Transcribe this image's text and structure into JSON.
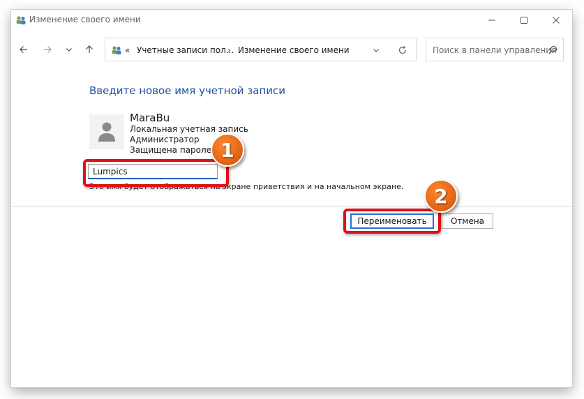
{
  "window": {
    "title": "Изменение своего имени",
    "title_icon": "user-accounts-icon"
  },
  "navigation": {
    "breadcrumb_overflow": "«",
    "breadcrumbs": [
      "Учетные записи пол...",
      "Изменение своего имени"
    ],
    "search_placeholder": "Поиск в панели управления"
  },
  "main": {
    "heading": "Введите новое имя учетной записи",
    "user": {
      "name": "MaraBu",
      "type": "Локальная учетная запись",
      "role": "Администратор",
      "protection": "Защищена паролем",
      "avatar_icon": "user-avatar-icon"
    },
    "name_input": {
      "value": "Lumpics"
    },
    "hint": "Это имя будет отображаться на экране приветствия и на начальном экране.",
    "rename_button": "Переименовать",
    "cancel_button": "Отмена"
  },
  "annotations": {
    "marker_1": "1",
    "marker_2": "2",
    "highlight_color": "#e0101a",
    "marker_color": "#e8671a"
  },
  "colors": {
    "heading": "#1f4e9c",
    "accent": "#1f5fbf"
  }
}
